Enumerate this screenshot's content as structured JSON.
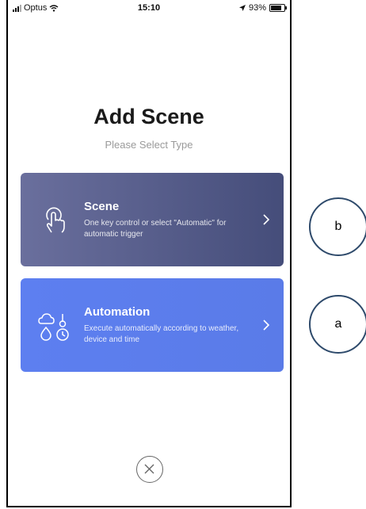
{
  "statusbar": {
    "carrier": "Optus",
    "time": "15:10",
    "battery": "93%",
    "battery_level": 0.93
  },
  "header": {
    "title": "Add Scene",
    "subtitle": "Please Select Type"
  },
  "cards": [
    {
      "title": "Scene",
      "description": "One key control or select \"Automatic\" for automatic trigger",
      "icon": "hand-tap-icon"
    },
    {
      "title": "Automation",
      "description": "Execute automatically according to weather, device and time",
      "icon": "weather-clock-icon"
    }
  ],
  "annotations": {
    "b": "b",
    "a": "a"
  },
  "colors": {
    "scene_card": "#4f5584",
    "automation_card": "#5b7cec",
    "callout_border": "#2e4a6b"
  }
}
